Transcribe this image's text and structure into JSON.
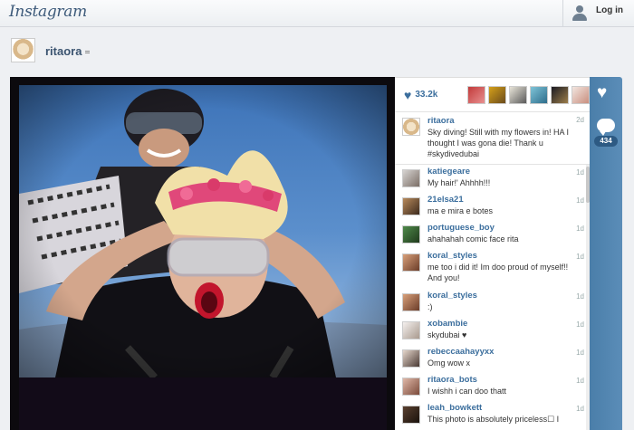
{
  "header": {
    "logo": "Instagram",
    "login_label": "Log in"
  },
  "profile": {
    "username": "ritaora"
  },
  "post": {
    "likes": "33.2k",
    "caption_user": "ritaora",
    "caption_time": "2d",
    "caption_text": "Sky diving! Still with my flowers in! HA I thought I was gona die! Thank u #skydivedubai",
    "comment_count": "434"
  },
  "colors": {
    "accent": "#3b6e9d",
    "action_bar": "#4f84af"
  },
  "comments": [
    {
      "user": "katiegeare",
      "text": "My hair!' Ahhhh!!!",
      "time": "1d"
    },
    {
      "user": "21elsa21",
      "text": "ma e mira e botes",
      "time": "1d"
    },
    {
      "user": "portuguese_boy",
      "text": "ahahahah comic face rita",
      "time": "1d"
    },
    {
      "user": "koral_styles",
      "text": "me too i did it! Im doo proud of myself!! And you!",
      "time": "1d"
    },
    {
      "user": "koral_styles",
      "text": ":)",
      "time": "1d"
    },
    {
      "user": "xobambie",
      "text": "skydubai ♥",
      "time": "1d"
    },
    {
      "user": "rebeccaahayyxx",
      "text": "Omg wow x",
      "time": "1d"
    },
    {
      "user": "ritaora_bots",
      "text": "I wishh i can doo thatt",
      "time": "1d"
    },
    {
      "user": "leah_bowkett",
      "text": "This photo is absolutely priceless☐ I",
      "time": "1d"
    }
  ]
}
